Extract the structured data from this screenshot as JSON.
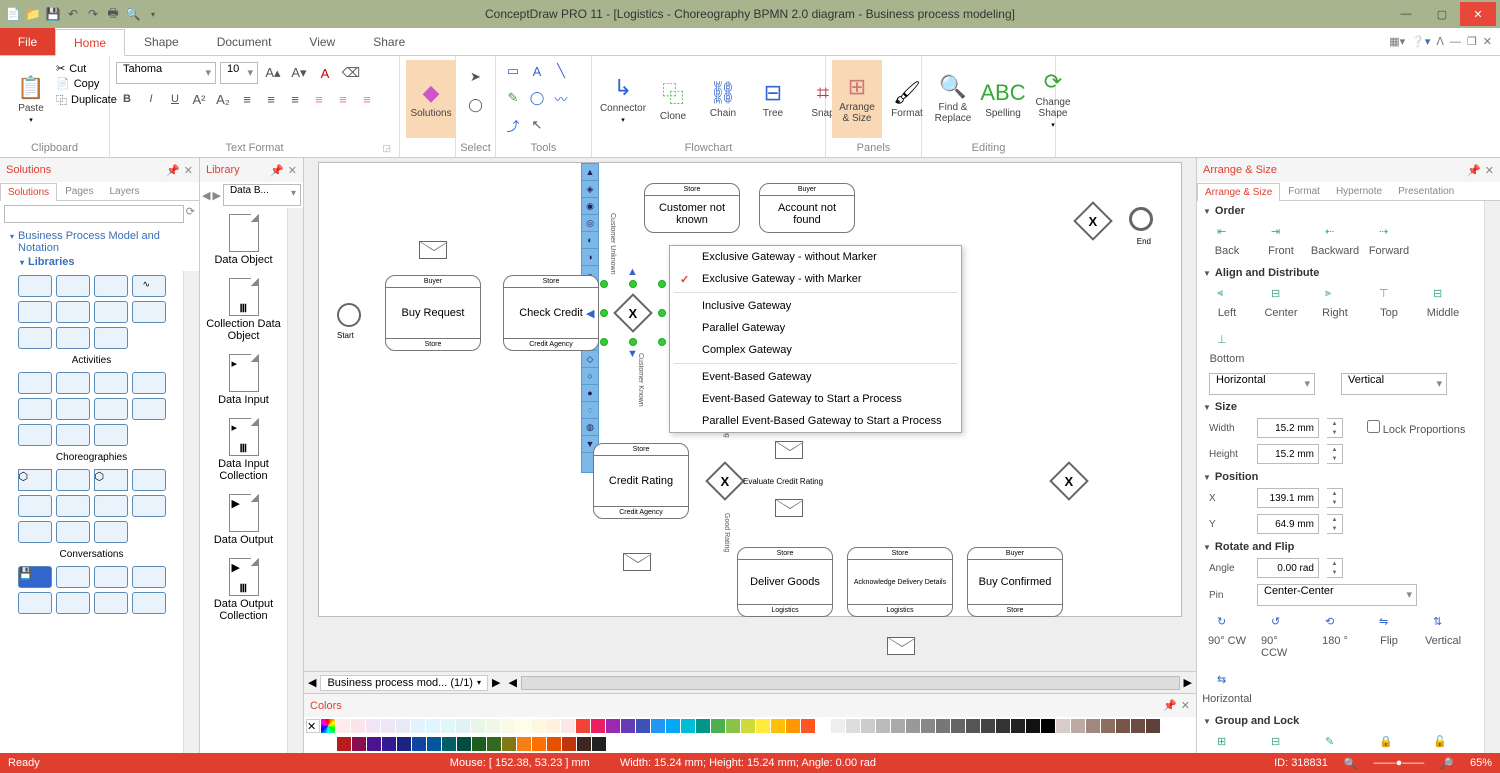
{
  "titlebar": {
    "title": "ConceptDraw PRO 11 - [Logistics - Choreography BPMN 2.0 diagram - Business process modeling]"
  },
  "menu": {
    "file": "File",
    "tabs": [
      "Home",
      "Shape",
      "Document",
      "View",
      "Share"
    ]
  },
  "ribbon": {
    "clipboard": {
      "label": "Clipboard",
      "paste": "Paste",
      "cut": "Cut",
      "copy": "Copy",
      "dup": "Duplicate"
    },
    "text": {
      "label": "Text Format",
      "font": "Tahoma",
      "size": "10"
    },
    "solutions": {
      "label": "Solutions",
      "btn": "Solutions"
    },
    "select": {
      "label": "Select"
    },
    "tools": {
      "label": "Tools"
    },
    "flowchart": {
      "label": "Flowchart",
      "connector": "Connector",
      "clone": "Clone",
      "chain": "Chain",
      "tree": "Tree",
      "snap": "Snap"
    },
    "panels": {
      "label": "Panels",
      "arrange": "Arrange & Size",
      "format": "Format"
    },
    "editing": {
      "label": "Editing",
      "find": "Find & Replace",
      "spelling": "Spelling",
      "change": "Change Shape"
    }
  },
  "solutions_panel": {
    "title": "Solutions",
    "tabs": [
      "Solutions",
      "Pages",
      "Layers"
    ],
    "tree": [
      "Business Process Model and Notation",
      "Libraries"
    ],
    "groups": [
      "Activities",
      "Choreographies",
      "Conversations"
    ]
  },
  "library_panel": {
    "title": "Library",
    "combo": "Data B...",
    "items": [
      "Data Object",
      "Collection Data Object",
      "Data Input",
      "Data Input Collection",
      "Data Output",
      "Data Output Collection"
    ]
  },
  "canvas": {
    "start": "Start",
    "end": "End",
    "nodes": {
      "buy_request": {
        "top": "Buyer",
        "mid": "Buy Request",
        "bot": "Store"
      },
      "check_credit": {
        "top": "Store",
        "mid": "Check Credit",
        "bot": "Credit Agency"
      },
      "store_customer": {
        "top": "Store",
        "mid": "Customer not known"
      },
      "buyer_account": {
        "top": "Buyer",
        "mid": "Account not found"
      },
      "credit_rating": {
        "top": "Store",
        "mid": "Credit Rating",
        "bot": "Credit Agency"
      },
      "eval": "Evaluate Credit Rating",
      "deliver": {
        "top": "Store",
        "mid": "Deliver Goods",
        "bot": "Logistics"
      },
      "ack": {
        "top": "Store",
        "mid": "Acknowledge Delivery Details",
        "bot": "Logistics"
      },
      "confirm": {
        "top": "Buyer",
        "mid": "Buy Confirmed",
        "bot": "Store"
      }
    },
    "vtext": {
      "unknown": "Customer Unknown",
      "known": "Customer Known",
      "bad": "Bad Rating",
      "good": "Good Rating"
    }
  },
  "context_menu": {
    "items": [
      {
        "label": "Exclusive Gateway - without Marker",
        "sep": false
      },
      {
        "label": "Exclusive Gateway - with Marker",
        "chk": true,
        "sep": true
      },
      {
        "label": "Inclusive Gateway",
        "sep": false
      },
      {
        "label": "Parallel Gateway",
        "sep": false
      },
      {
        "label": "Complex Gateway",
        "sep": true
      },
      {
        "label": "Event-Based Gateway",
        "sep": false
      },
      {
        "label": "Event-Based Gateway to Start a Process",
        "sep": false
      },
      {
        "label": "Parallel  Event-Based Gateway to Start a Process",
        "sep": false
      }
    ]
  },
  "arrange_panel": {
    "title": "Arrange & Size",
    "tabs": [
      "Arrange & Size",
      "Format",
      "Hypernote",
      "Presentation"
    ],
    "order": {
      "label": "Order",
      "btns": [
        "Back",
        "Front",
        "Backward",
        "Forward"
      ]
    },
    "align": {
      "label": "Align and Distribute",
      "h": [
        "Left",
        "Center",
        "Right"
      ],
      "v": [
        "Top",
        "Middle",
        "Bottom"
      ],
      "hsel": "Horizontal",
      "vsel": "Vertical"
    },
    "size": {
      "label": "Size",
      "w": "Width",
      "h": "Height",
      "wv": "15.2 mm",
      "hv": "15.2 mm",
      "lock": "Lock Proportions"
    },
    "position": {
      "label": "Position",
      "x": "X",
      "y": "Y",
      "xv": "139.1 mm",
      "yv": "64.9 mm"
    },
    "rotate": {
      "label": "Rotate and Flip",
      "angle": "Angle",
      "av": "0.00 rad",
      "pin": "Pin",
      "pv": "Center-Center",
      "btns": [
        "90° CW",
        "90° CCW",
        "180 °",
        "Flip",
        "Vertical",
        "Horizontal"
      ]
    },
    "group": {
      "label": "Group and Lock",
      "btns": [
        "Group",
        "UnGroup",
        "Edit",
        "Lock",
        "UnLock"
      ]
    }
  },
  "doc_tabs": {
    "tab": "Business process mod... (1/1)"
  },
  "colors": {
    "title": "Colors"
  },
  "status": {
    "ready": "Ready",
    "mouse": "Mouse: [ 152.38, 53.23 ] mm",
    "dim": "Width: 15.24 mm;   Height: 15.24 mm;  Angle: 0.00 rad",
    "id": "ID: 318831",
    "zoom": "65%"
  }
}
